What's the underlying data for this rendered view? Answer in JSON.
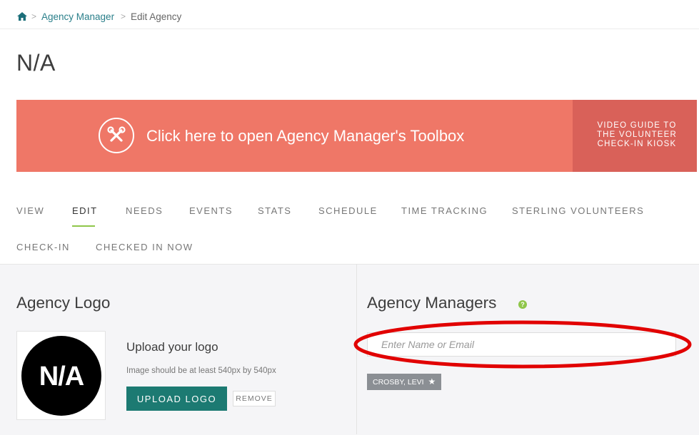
{
  "breadcrumb": {
    "items": [
      "Agency Manager",
      "Edit Agency"
    ],
    "separator": ">"
  },
  "page": {
    "title": "N/A"
  },
  "banner": {
    "toolbox_text": "Click here to open Agency Manager's Toolbox",
    "video_guide_text": "VIDEO GUIDE TO THE VOLUNTEER CHECK-IN KIOSK",
    "color": "#ef7767",
    "video_color": "#d96159"
  },
  "tabs": [
    {
      "label": "VIEW"
    },
    {
      "label": "EDIT",
      "active": true
    },
    {
      "label": "NEEDS"
    },
    {
      "label": "EVENTS"
    },
    {
      "label": "STATS"
    },
    {
      "label": "SCHEDULE"
    },
    {
      "label": "TIME TRACKING"
    },
    {
      "label": "STERLING VOLUNTEERS"
    },
    {
      "label": "CHECK-IN"
    },
    {
      "label": "CHECKED IN NOW"
    }
  ],
  "logo_section": {
    "heading": "Agency Logo",
    "logo_text": "N/A",
    "upload_title": "Upload your logo",
    "upload_hint": "Image should be at least 540px by 540px",
    "upload_button": "UPLOAD LOGO",
    "remove_button": "REMOVE"
  },
  "managers_section": {
    "heading": "Agency Managers",
    "help_icon": "?",
    "input_placeholder": "Enter Name or Email",
    "input_value": "",
    "managers": [
      {
        "name": "CROSBY, LEVI",
        "icon": "star-icon"
      }
    ]
  },
  "colors": {
    "accent_green": "#8fc64a",
    "primary_teal": "#1c7a72",
    "link": "#2a7f8a",
    "highlight": "#e10000"
  }
}
